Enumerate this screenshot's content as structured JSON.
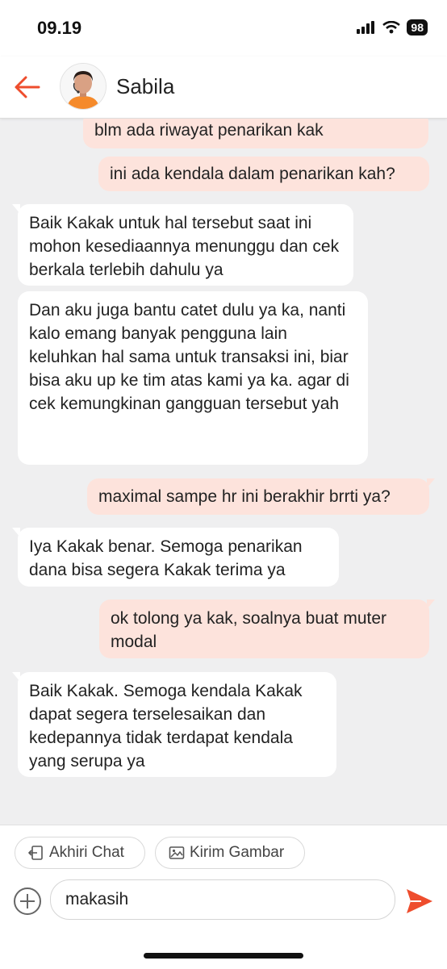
{
  "status_bar": {
    "time": "09.19",
    "battery": "98"
  },
  "header": {
    "contact_name": "Sabila"
  },
  "messages": [
    {
      "sender": "user",
      "text": "blm ada riwayat penarikan kak"
    },
    {
      "sender": "user",
      "text": "ini ada kendala dalam penarikan kah?"
    },
    {
      "sender": "agent",
      "text": "Baik Kakak untuk hal tersebut saat ini mohon kesediaannya menunggu dan cek berkala terlebih dahulu ya"
    },
    {
      "sender": "agent",
      "text": "Dan aku juga bantu catet dulu ya ka, nanti kalo emang banyak pengguna lain keluhkan hal sama untuk transaksi ini, biar bisa aku up ke tim atas kami ya ka. agar di cek kemungkinan gangguan tersebut yah"
    },
    {
      "sender": "user",
      "text": "maximal sampe hr ini berakhir brrti ya?"
    },
    {
      "sender": "agent",
      "text": "Iya Kakak benar. Semoga penarikan dana bisa segera Kakak terima ya"
    },
    {
      "sender": "user",
      "text": "ok tolong ya kak, soalnya buat muter modal"
    },
    {
      "sender": "agent",
      "text": "Baik Kakak. Semoga kendala Kakak dapat segera terselesaikan dan kedepannya tidak terdapat kendala yang serupa ya"
    }
  ],
  "actions": {
    "end_chat_label": "Akhiri Chat",
    "send_image_label": "Kirim Gambar"
  },
  "composer": {
    "input_value": "makasih"
  },
  "colors": {
    "accent": "#ee4d2d",
    "outgoing_bubble": "#fde3dc",
    "incoming_bubble": "#ffffff",
    "background": "#efeff0"
  },
  "icons": [
    "back-arrow-icon",
    "signal-icon",
    "wifi-icon",
    "battery-icon",
    "exit-icon",
    "image-icon",
    "plus-icon",
    "send-icon"
  ]
}
